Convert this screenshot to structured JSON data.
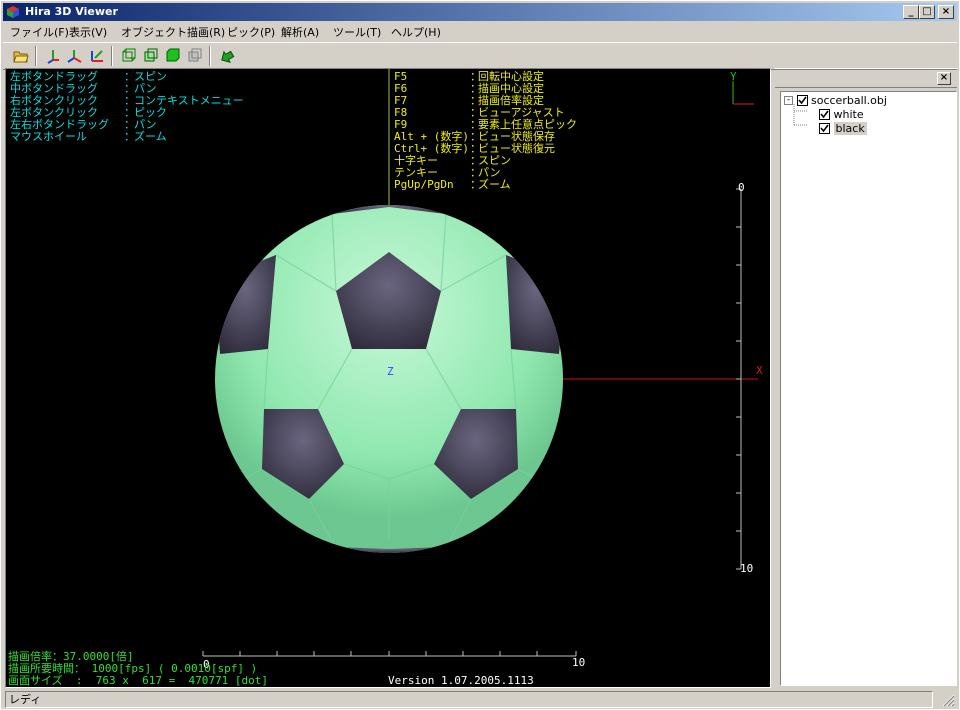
{
  "window": {
    "title": "Hira 3D Viewer",
    "minimize_label": "_",
    "maximize_label": "□",
    "close_label": "×"
  },
  "menu": [
    {
      "label": "ファイル(F)"
    },
    {
      "label": "表示(V)"
    },
    {
      "label": "オブジェクト描画(R)"
    },
    {
      "label": "ピック(P)"
    },
    {
      "label": "解析(A)"
    },
    {
      "label": "ツール(T)"
    },
    {
      "label": "ヘルプ(H)"
    }
  ],
  "toolbar_icons": [
    "open-file-icon",
    "axis-y-icon",
    "axis-xy-icon",
    "axis-zx-icon",
    "wireframe-icon",
    "wire-cube-icon",
    "solid-cube-icon",
    "disabled-cube-icon",
    "arrow-icon"
  ],
  "help_left": [
    {
      "key": "左ボタンドラッグ",
      "sep": "：",
      "action": "スピン"
    },
    {
      "key": "中ボタンドラッグ",
      "sep": "：",
      "action": "パン"
    },
    {
      "key": "右ボタンクリック",
      "sep": "：",
      "action": "コンテキストメニュー"
    },
    {
      "key": "左ボタンクリック",
      "sep": "：",
      "action": "ピック"
    },
    {
      "key": "左右ボタンドラッグ",
      "sep": "：",
      "action": "パン"
    },
    {
      "key": "マウスホイール",
      "sep": "：",
      "action": "ズーム"
    }
  ],
  "help_right": [
    {
      "key": "F5",
      "sep": "：",
      "action": "回転中心設定"
    },
    {
      "key": "F6",
      "sep": "：",
      "action": "描画中心設定"
    },
    {
      "key": "F7",
      "sep": "：",
      "action": "描画倍率設定"
    },
    {
      "key": "F8",
      "sep": "：",
      "action": "ビューアジャスト"
    },
    {
      "key": "F9",
      "sep": "：",
      "action": "要素上任意点ピック"
    },
    {
      "key": "Alt + (数字)",
      "sep": "：",
      "action": "ビュー状態保存"
    },
    {
      "key": "Ctrl+ (数字)",
      "sep": "：",
      "action": "ビュー状態復元"
    },
    {
      "key": "十字キー",
      "sep": "：",
      "action": "スピン"
    },
    {
      "key": "テンキー",
      "sep": "：",
      "action": "パン"
    },
    {
      "key": "PgUp/PgDn",
      "sep": "：",
      "action": "ズーム"
    }
  ],
  "axes": {
    "x_label": "X",
    "y_label": "Y",
    "z_label": "Z",
    "ruler_v_top": "0",
    "ruler_v_bottom": "10",
    "ruler_h_left": "0",
    "ruler_h_right": "10"
  },
  "stats": {
    "zoom": "描画倍率：37.0000[倍]",
    "time": "描画所要時間： 1000[fps] ( 0.0010[spf] )",
    "size": "画面サイズ  :  763 x  617 =  470771 [dot]"
  },
  "version": "Version 1.07.2005.1113",
  "tree": {
    "close_label": "×",
    "root": {
      "label": "soccerball.obj",
      "expander": "-",
      "checked": true
    },
    "children": [
      {
        "label": "white",
        "checked": true
      },
      {
        "label": "black",
        "checked": true
      }
    ]
  },
  "status": {
    "text": "レディ"
  },
  "colors": {
    "ball_white_patch": "#9ff0c0",
    "ball_black_patch": "#4a4658",
    "title_start": "#0a246a",
    "title_end": "#a6caf0",
    "help_left": "#00e0e0",
    "help_right": "#f0f000",
    "stats": "#30e030",
    "x_axis": "#e01010",
    "y_axis": "#20c020",
    "z_axis": "#2020ff"
  }
}
